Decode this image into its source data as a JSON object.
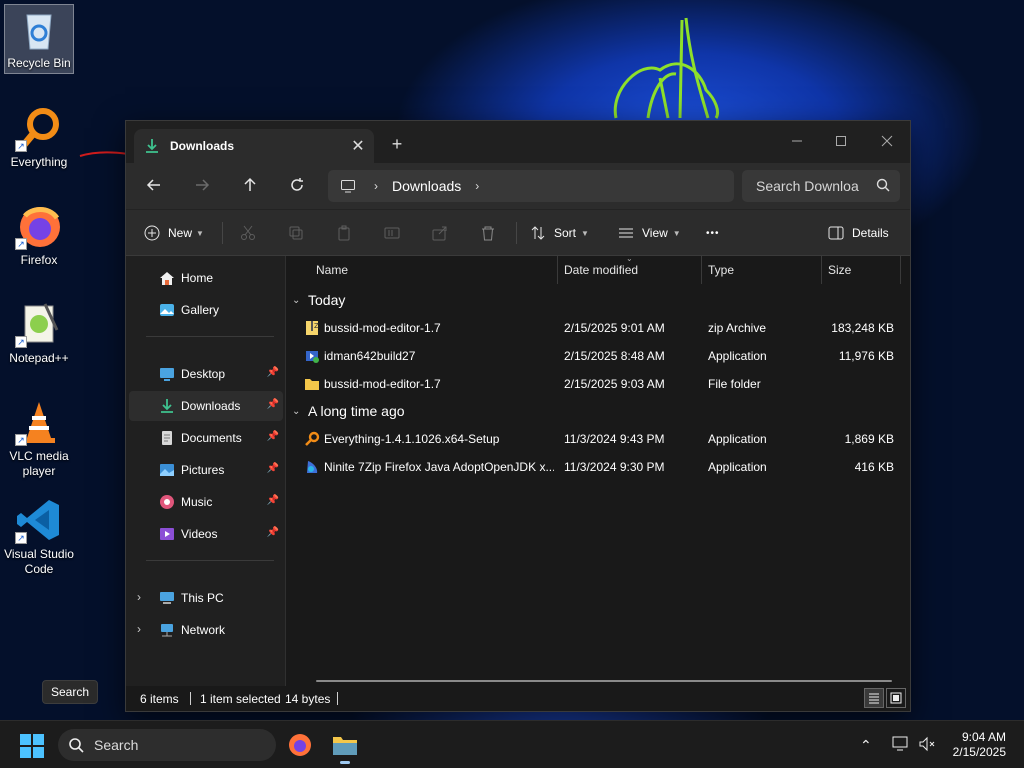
{
  "desktop": {
    "icons": [
      {
        "label": "Recycle Bin",
        "icon": "recycle-bin-icon"
      },
      {
        "label": "Everything",
        "icon": "everything-search-icon"
      },
      {
        "label": "Firefox",
        "icon": "firefox-icon"
      },
      {
        "label": "Notepad++",
        "icon": "notepad-plus-plus-icon"
      },
      {
        "label": "VLC media player",
        "icon": "vlc-cone-icon"
      },
      {
        "label": "Visual Studio Code",
        "icon": "vscode-icon"
      }
    ],
    "tooltip": "Search"
  },
  "window": {
    "tab_title": "Downloads",
    "address_segments": [
      "Downloads"
    ],
    "search_placeholder": "Search Downloa",
    "toolbar": {
      "new_label": "New",
      "sort_label": "Sort",
      "view_label": "View",
      "more_label": "•••",
      "details_label": "Details"
    },
    "sidebar": {
      "top": [
        {
          "label": "Home",
          "icon": "home-icon"
        },
        {
          "label": "Gallery",
          "icon": "gallery-icon"
        }
      ],
      "quick": [
        {
          "label": "Desktop",
          "icon": "desktop-folder-icon",
          "pinned": true
        },
        {
          "label": "Downloads",
          "icon": "downloads-folder-icon",
          "pinned": true,
          "active": true
        },
        {
          "label": "Documents",
          "icon": "documents-folder-icon",
          "pinned": true
        },
        {
          "label": "Pictures",
          "icon": "pictures-folder-icon",
          "pinned": true
        },
        {
          "label": "Music",
          "icon": "music-folder-icon",
          "pinned": true
        },
        {
          "label": "Videos",
          "icon": "videos-folder-icon",
          "pinned": true
        }
      ],
      "bottom": [
        {
          "label": "This PC",
          "icon": "this-pc-icon"
        },
        {
          "label": "Network",
          "icon": "network-icon"
        }
      ]
    },
    "columns": [
      "Name",
      "Date modified",
      "Type",
      "Size"
    ],
    "groups": [
      {
        "title": "Today",
        "files": [
          {
            "name": "bussid-mod-editor-1.7",
            "date": "2/15/2025 9:01 AM",
            "type": "zip Archive",
            "size": "183,248 KB",
            "icon": "zip-archive-icon"
          },
          {
            "name": "idman642build27",
            "date": "2/15/2025 8:48 AM",
            "type": "Application",
            "size": "11,976 KB",
            "icon": "installer-icon"
          },
          {
            "name": "bussid-mod-editor-1.7",
            "date": "2/15/2025 9:03 AM",
            "type": "File folder",
            "size": "",
            "icon": "folder-icon"
          }
        ]
      },
      {
        "title": "A long time ago",
        "files": [
          {
            "name": "Everything-1.4.1.1026.x64-Setup",
            "date": "11/3/2024 9:43 PM",
            "type": "Application",
            "size": "1,869 KB",
            "icon": "everything-search-icon"
          },
          {
            "name": "Ninite 7Zip Firefox Java AdoptOpenJDK x...",
            "date": "11/3/2024 9:30 PM",
            "type": "Application",
            "size": "416 KB",
            "icon": "ninite-icon"
          }
        ]
      }
    ],
    "status": {
      "items": "6 items",
      "selected": "1 item selected",
      "bytes": "14 bytes"
    }
  },
  "taskbar": {
    "search_label": "Search",
    "time": "9:04 AM",
    "date": "2/15/2025"
  }
}
